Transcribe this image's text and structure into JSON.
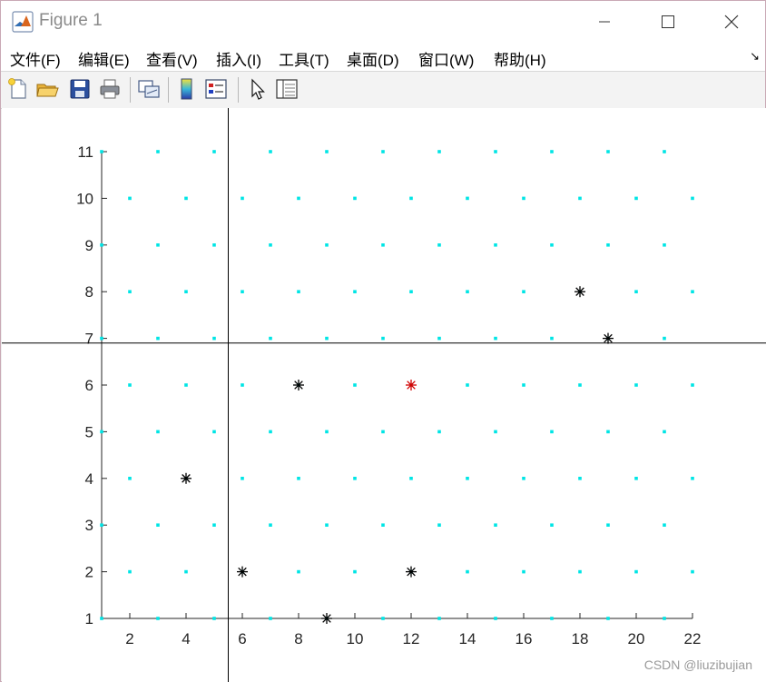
{
  "window": {
    "title": "Figure 1",
    "watermark": "CSDN @liuzibujian"
  },
  "menu": {
    "items": [
      {
        "label": "文件(F)"
      },
      {
        "label": "编辑(E)"
      },
      {
        "label": "查看(V)"
      },
      {
        "label": "插入(I)"
      },
      {
        "label": "工具(T)"
      },
      {
        "label": "桌面(D)"
      },
      {
        "label": "窗口(W)"
      },
      {
        "label": "帮助(H)"
      }
    ],
    "dock_arrow": "↘"
  },
  "toolbar": {
    "icons": [
      "new-figure-icon",
      "open-file-icon",
      "save-icon",
      "print-icon",
      "link-plot-icon",
      "colorbar-icon",
      "legend-icon",
      "pointer-icon",
      "property-inspector-icon"
    ]
  },
  "chart_data": {
    "type": "scatter",
    "xlim": [
      1,
      22
    ],
    "ylim": [
      1,
      11
    ],
    "xticks": [
      2,
      4,
      6,
      8,
      10,
      12,
      14,
      16,
      18,
      20,
      22
    ],
    "yticks": [
      1,
      2,
      3,
      4,
      5,
      6,
      7,
      8,
      9,
      10,
      11
    ],
    "grid": false,
    "colors": {
      "grid_points": "#00e5e5",
      "black_marks": "#000000",
      "red_mark": "#d40000",
      "lines": "#000000"
    },
    "grid_points_rule": "x - y even",
    "black_stars": [
      [
        18,
        8
      ],
      [
        19,
        7
      ],
      [
        8,
        6
      ],
      [
        4,
        4
      ],
      [
        6,
        2
      ],
      [
        12,
        2
      ],
      [
        9,
        1
      ]
    ],
    "red_stars": [
      [
        12,
        6
      ]
    ],
    "vertical_line_x": 5.5,
    "horizontal_line_y": 6.9
  }
}
